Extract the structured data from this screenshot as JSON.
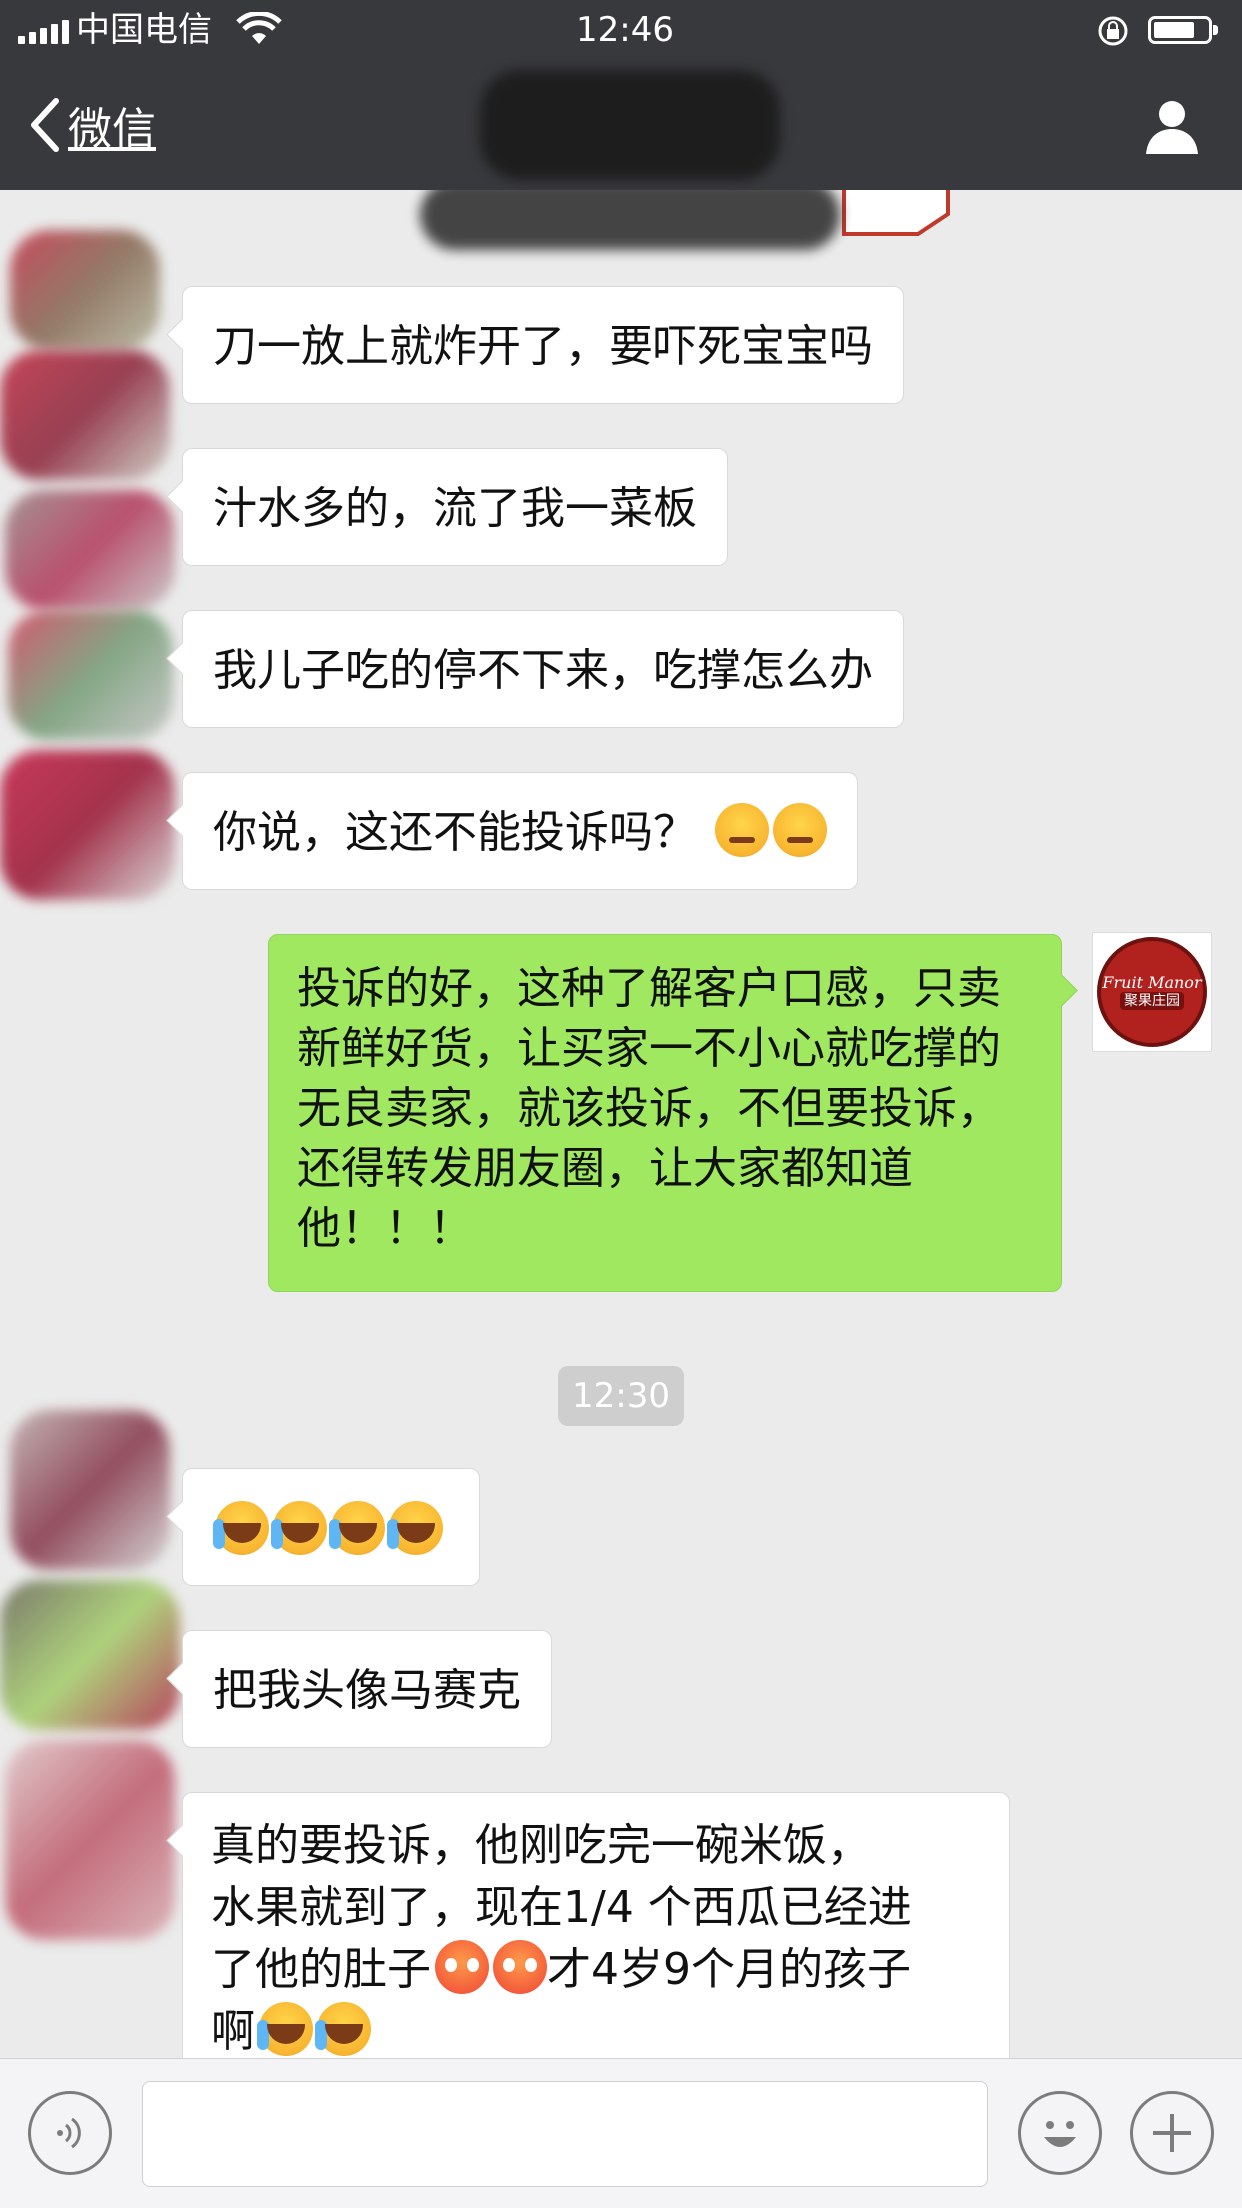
{
  "status_bar": {
    "carrier": "中国电信",
    "time": "12:46"
  },
  "nav": {
    "back_label": "微信"
  },
  "messages": [
    {
      "side": "left",
      "text": "刀一放上就炸开了，要吓死宝宝吗"
    },
    {
      "side": "left",
      "text": "汁水多的，流了我一菜板"
    },
    {
      "side": "left",
      "text": "我儿子吃的停不下来，吃撑怎么办"
    },
    {
      "side": "left",
      "text": "你说，这还不能投诉吗？",
      "emoji": [
        "smirk",
        "smirk"
      ]
    },
    {
      "side": "right",
      "text": "投诉的好，这种了解客户口感，只卖新鲜好货，让买家一不小心就吃撑的无良卖家，就该投诉，不但要投诉，还得转发朋友圈，让大家都知道他！！！"
    },
    {
      "side": "left",
      "text": "",
      "emoji": [
        "cry",
        "cry",
        "cry",
        "cry"
      ]
    },
    {
      "side": "left",
      "text": "把我头像马赛克"
    },
    {
      "side": "left",
      "lines": [
        "真的要投诉，他刚吃完一碗米饭，",
        "水果就到了，现在1/4 个西瓜已经进",
        "了他的肚子",
        "才4岁9个月的孩子",
        "啊"
      ],
      "emoji": [
        "flushed",
        "flushed",
        "cry",
        "cry"
      ]
    }
  ],
  "timestamp": "12:30",
  "avatar_right": {
    "logo_line1": "Fruit Manor",
    "logo_line2": "聚果庄园"
  },
  "icons": [
    "signal-icon",
    "wifi-icon",
    "lock-rotation-icon",
    "battery-icon",
    "back-chevron-icon",
    "user-icon",
    "voice-icon",
    "emoji-icon",
    "plus-icon"
  ]
}
